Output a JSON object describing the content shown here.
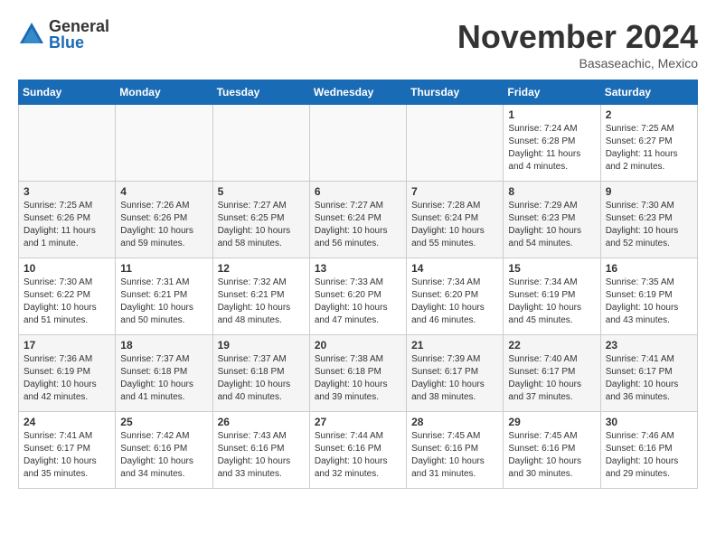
{
  "header": {
    "logo": {
      "general": "General",
      "blue": "Blue"
    },
    "title": "November 2024",
    "location": "Basaseachic, Mexico"
  },
  "days_of_week": [
    "Sunday",
    "Monday",
    "Tuesday",
    "Wednesday",
    "Thursday",
    "Friday",
    "Saturday"
  ],
  "weeks": [
    {
      "days": [
        {
          "date": "",
          "info": ""
        },
        {
          "date": "",
          "info": ""
        },
        {
          "date": "",
          "info": ""
        },
        {
          "date": "",
          "info": ""
        },
        {
          "date": "",
          "info": ""
        },
        {
          "date": "1",
          "sunrise": "7:24 AM",
          "sunset": "6:28 PM",
          "daylight": "11 hours and 4 minutes."
        },
        {
          "date": "2",
          "sunrise": "7:25 AM",
          "sunset": "6:27 PM",
          "daylight": "11 hours and 2 minutes."
        }
      ]
    },
    {
      "days": [
        {
          "date": "3",
          "sunrise": "7:25 AM",
          "sunset": "6:26 PM",
          "daylight": "11 hours and 1 minute."
        },
        {
          "date": "4",
          "sunrise": "7:26 AM",
          "sunset": "6:26 PM",
          "daylight": "10 hours and 59 minutes."
        },
        {
          "date": "5",
          "sunrise": "7:27 AM",
          "sunset": "6:25 PM",
          "daylight": "10 hours and 58 minutes."
        },
        {
          "date": "6",
          "sunrise": "7:27 AM",
          "sunset": "6:24 PM",
          "daylight": "10 hours and 56 minutes."
        },
        {
          "date": "7",
          "sunrise": "7:28 AM",
          "sunset": "6:24 PM",
          "daylight": "10 hours and 55 minutes."
        },
        {
          "date": "8",
          "sunrise": "7:29 AM",
          "sunset": "6:23 PM",
          "daylight": "10 hours and 54 minutes."
        },
        {
          "date": "9",
          "sunrise": "7:30 AM",
          "sunset": "6:23 PM",
          "daylight": "10 hours and 52 minutes."
        }
      ]
    },
    {
      "days": [
        {
          "date": "10",
          "sunrise": "7:30 AM",
          "sunset": "6:22 PM",
          "daylight": "10 hours and 51 minutes."
        },
        {
          "date": "11",
          "sunrise": "7:31 AM",
          "sunset": "6:21 PM",
          "daylight": "10 hours and 50 minutes."
        },
        {
          "date": "12",
          "sunrise": "7:32 AM",
          "sunset": "6:21 PM",
          "daylight": "10 hours and 48 minutes."
        },
        {
          "date": "13",
          "sunrise": "7:33 AM",
          "sunset": "6:20 PM",
          "daylight": "10 hours and 47 minutes."
        },
        {
          "date": "14",
          "sunrise": "7:34 AM",
          "sunset": "6:20 PM",
          "daylight": "10 hours and 46 minutes."
        },
        {
          "date": "15",
          "sunrise": "7:34 AM",
          "sunset": "6:19 PM",
          "daylight": "10 hours and 45 minutes."
        },
        {
          "date": "16",
          "sunrise": "7:35 AM",
          "sunset": "6:19 PM",
          "daylight": "10 hours and 43 minutes."
        }
      ]
    },
    {
      "days": [
        {
          "date": "17",
          "sunrise": "7:36 AM",
          "sunset": "6:19 PM",
          "daylight": "10 hours and 42 minutes."
        },
        {
          "date": "18",
          "sunrise": "7:37 AM",
          "sunset": "6:18 PM",
          "daylight": "10 hours and 41 minutes."
        },
        {
          "date": "19",
          "sunrise": "7:37 AM",
          "sunset": "6:18 PM",
          "daylight": "10 hours and 40 minutes."
        },
        {
          "date": "20",
          "sunrise": "7:38 AM",
          "sunset": "6:18 PM",
          "daylight": "10 hours and 39 minutes."
        },
        {
          "date": "21",
          "sunrise": "7:39 AM",
          "sunset": "6:17 PM",
          "daylight": "10 hours and 38 minutes."
        },
        {
          "date": "22",
          "sunrise": "7:40 AM",
          "sunset": "6:17 PM",
          "daylight": "10 hours and 37 minutes."
        },
        {
          "date": "23",
          "sunrise": "7:41 AM",
          "sunset": "6:17 PM",
          "daylight": "10 hours and 36 minutes."
        }
      ]
    },
    {
      "days": [
        {
          "date": "24",
          "sunrise": "7:41 AM",
          "sunset": "6:17 PM",
          "daylight": "10 hours and 35 minutes."
        },
        {
          "date": "25",
          "sunrise": "7:42 AM",
          "sunset": "6:16 PM",
          "daylight": "10 hours and 34 minutes."
        },
        {
          "date": "26",
          "sunrise": "7:43 AM",
          "sunset": "6:16 PM",
          "daylight": "10 hours and 33 minutes."
        },
        {
          "date": "27",
          "sunrise": "7:44 AM",
          "sunset": "6:16 PM",
          "daylight": "10 hours and 32 minutes."
        },
        {
          "date": "28",
          "sunrise": "7:45 AM",
          "sunset": "6:16 PM",
          "daylight": "10 hours and 31 minutes."
        },
        {
          "date": "29",
          "sunrise": "7:45 AM",
          "sunset": "6:16 PM",
          "daylight": "10 hours and 30 minutes."
        },
        {
          "date": "30",
          "sunrise": "7:46 AM",
          "sunset": "6:16 PM",
          "daylight": "10 hours and 29 minutes."
        }
      ]
    }
  ]
}
